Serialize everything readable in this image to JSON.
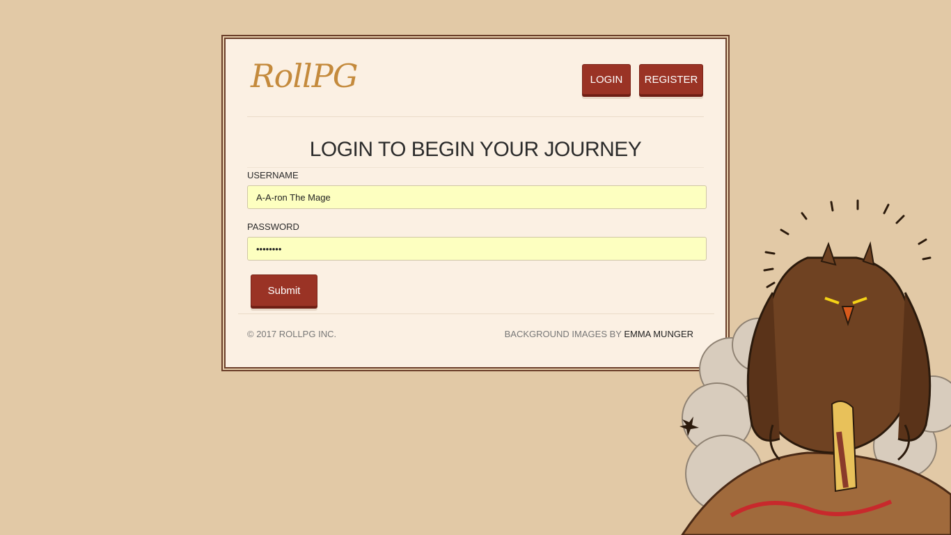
{
  "brand": {
    "logo_text": "RollPG",
    "logo_color": "#c48a3c"
  },
  "nav": {
    "login_label": "LOGIN",
    "register_label": "REGISTER"
  },
  "form": {
    "heading": "LOGIN TO BEGIN YOUR JOURNEY",
    "username_label": "USERNAME",
    "username_value": "A-A-ron The Mage",
    "password_label": "PASSWORD",
    "password_value": "••••••••",
    "submit_label": "Submit"
  },
  "footer": {
    "copyright": "© 2017 ROLLPG INC.",
    "credit_prefix": "BACKGROUND IMAGES BY ",
    "credit_name": "EMMA MUNGER"
  },
  "colors": {
    "page_background": "#e2c9a6",
    "card_background": "#fbf0e3",
    "card_border": "#6b3f2a",
    "button_primary": "#9a3325",
    "input_background": "#fdffc0"
  },
  "illustration": {
    "icon": "owl-monster-illustration"
  }
}
